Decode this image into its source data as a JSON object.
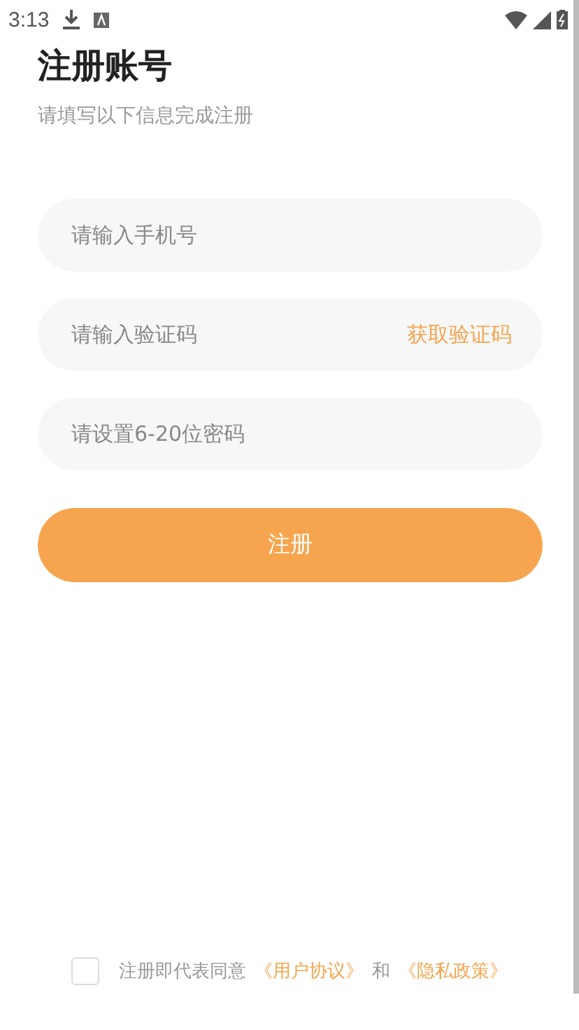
{
  "status_bar": {
    "time": "3:13"
  },
  "title": "注册账号",
  "subtitle": "请填写以下信息完成注册",
  "fields": [
    {
      "placeholder": "请输入手机号"
    },
    {
      "placeholder": "请输入验证码",
      "action": "获取验证码"
    },
    {
      "placeholder": "请设置6-20位密码"
    }
  ],
  "submit": "注册",
  "agreement": {
    "checked": false,
    "text": "注册即代表同意",
    "link_1": "《用户协议》",
    "joiner": "和",
    "link_2": "《隐私政策》"
  }
}
